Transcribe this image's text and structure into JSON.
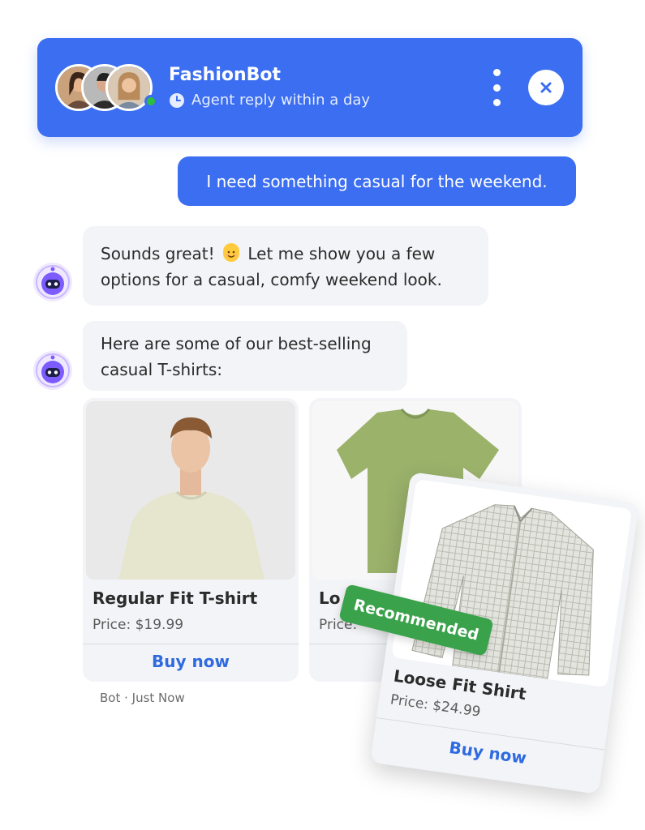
{
  "header": {
    "bot_name": "FashionBot",
    "reply_status": "Agent reply within a day",
    "icons": [
      "clock-icon",
      "more-vertical-icon",
      "close-icon"
    ],
    "accent_color": "#3b6ef0",
    "online_color": "#2dbe3d"
  },
  "messages": {
    "user_message": "I need something casual for the weekend.",
    "bot_message_1_line1_a": "Sounds great!",
    "bot_message_1_line1_b": "Let me show you a few",
    "bot_message_1_line2": "options for a casual, comfy weekend look.",
    "bot_message_2_line1": "Here are some of our best-selling",
    "bot_message_2_line2": "casual T-shirts:"
  },
  "products": [
    {
      "title": "Regular Fit T-shirt",
      "price": "Price: $19.99",
      "button": "Buy now"
    },
    {
      "title": "Lo",
      "price": "Price:",
      "button": ""
    },
    {
      "title": "Loose Fit Shirt",
      "price": "Price: $24.99",
      "button": "Buy now"
    }
  ],
  "badge": {
    "label": "Recommended",
    "color": "#3aa24a"
  },
  "meta": {
    "timestamp": "Bot · Just Now"
  }
}
